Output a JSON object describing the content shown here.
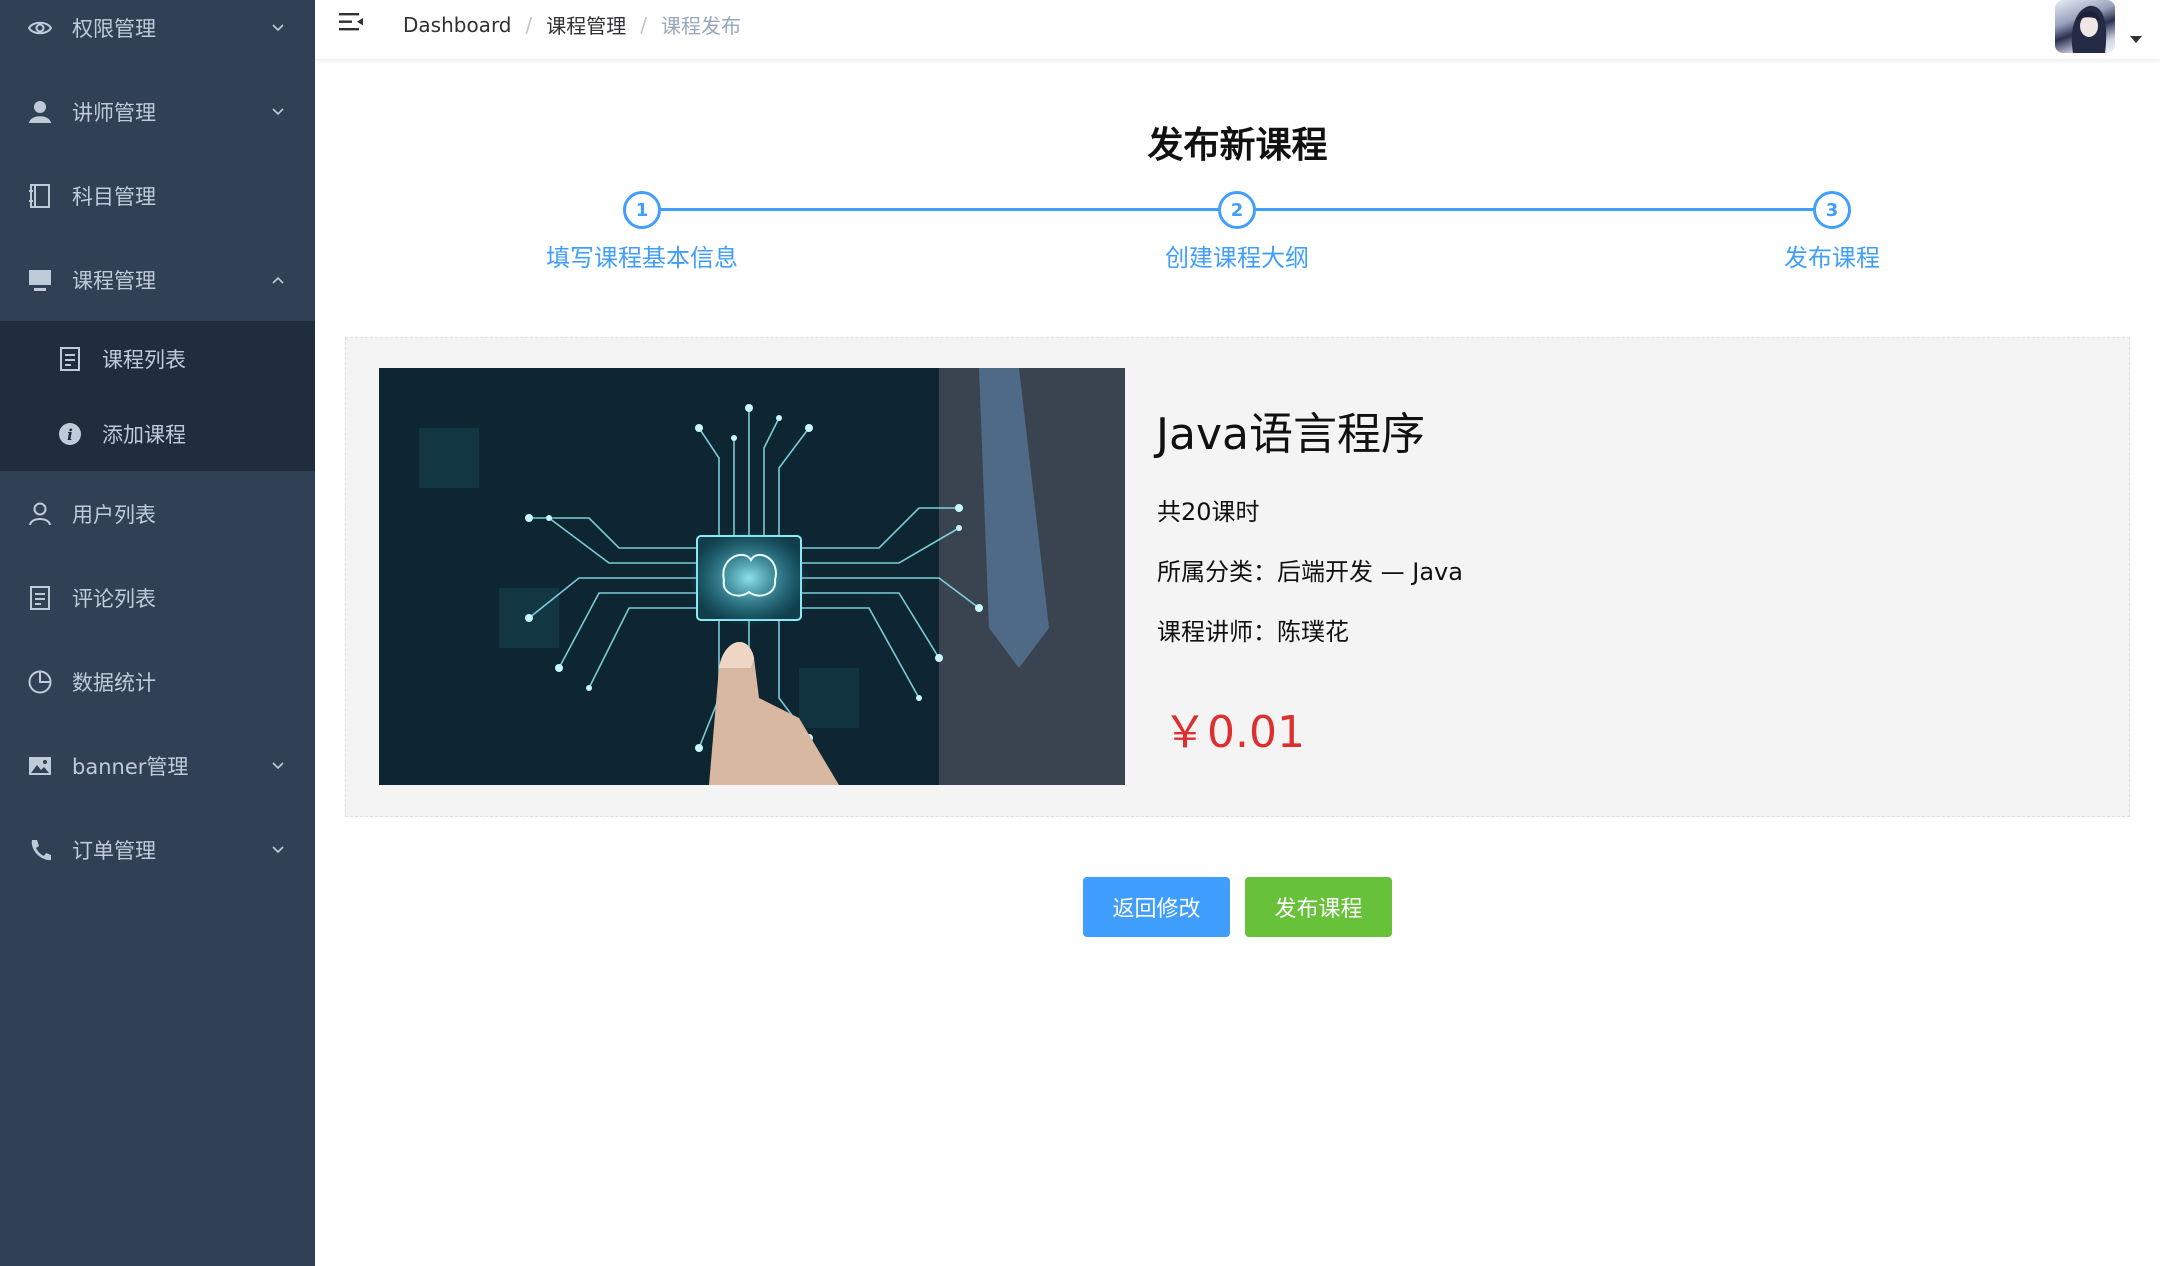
{
  "sidebar": {
    "items": [
      {
        "label": "权限管理",
        "icon": "eye-icon",
        "has_arrow": true,
        "expanded": false
      },
      {
        "label": "讲师管理",
        "icon": "user-filled-icon",
        "has_arrow": true,
        "expanded": false
      },
      {
        "label": "科目管理",
        "icon": "notebook-icon",
        "has_arrow": false
      },
      {
        "label": "课程管理",
        "icon": "monitor-icon",
        "has_arrow": true,
        "expanded": true
      },
      {
        "label": "用户列表",
        "icon": "user-icon",
        "has_arrow": false
      },
      {
        "label": "评论列表",
        "icon": "document-icon",
        "has_arrow": false
      },
      {
        "label": "数据统计",
        "icon": "pie-chart-icon",
        "has_arrow": false
      },
      {
        "label": "banner管理",
        "icon": "picture-icon",
        "has_arrow": true,
        "expanded": false
      },
      {
        "label": "订单管理",
        "icon": "phone-icon",
        "has_arrow": true,
        "expanded": false
      }
    ],
    "course_submenu": [
      {
        "label": "课程列表",
        "icon": "document-icon"
      },
      {
        "label": "添加课程",
        "icon": "info-icon"
      }
    ]
  },
  "navbar": {
    "breadcrumb": [
      "Dashboard",
      "课程管理",
      "课程发布"
    ],
    "breadcrumb_separator": "/"
  },
  "page": {
    "title": "发布新课程"
  },
  "steps": [
    {
      "number": "1",
      "label": "填写课程基本信息"
    },
    {
      "number": "2",
      "label": "创建课程大纲"
    },
    {
      "number": "3",
      "label": "发布课程"
    }
  ],
  "course": {
    "title": "Java语言程序",
    "lessons": "共20课时",
    "category": "所属分类：后端开发 — Java",
    "teacher": "课程讲师：陈璞花",
    "price": "￥0.01"
  },
  "buttons": {
    "back": "返回修改",
    "publish": "发布课程"
  },
  "colors": {
    "sidebar_bg": "#304156",
    "submenu_bg": "#1f2d3d",
    "sidebar_text": "#bfcbd9",
    "primary": "#409eff",
    "success": "#67c23a",
    "price": "#dd2f2f"
  }
}
